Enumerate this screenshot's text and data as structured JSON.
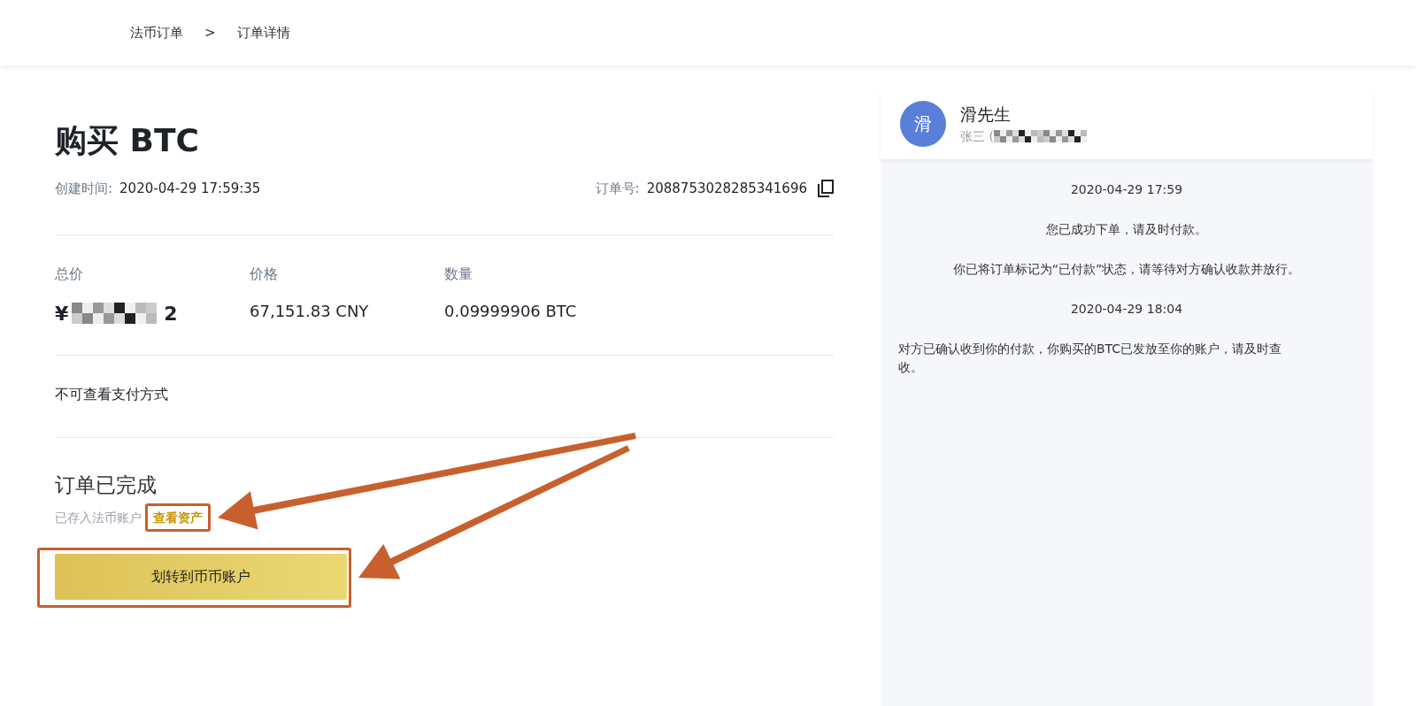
{
  "breadcrumb": [
    {
      "label": "法币订单"
    },
    {
      "label": ">"
    },
    {
      "label": "订单详情"
    }
  ],
  "order": {
    "title": "购买 BTC",
    "created_label": "创建时间:",
    "created_value": "2020-04-29 17:59:35",
    "number_label": "订单号:",
    "number_value": "2088753028285341696",
    "summary": [
      {
        "label": "总价",
        "value_start": "¥",
        "value_end": "2",
        "kind": "redacted"
      },
      {
        "label": "价格",
        "value_start": "67,151.83 CNY",
        "kind": "plain"
      },
      {
        "label": "数量",
        "value_start": "0.09999906 BTC",
        "kind": "plain"
      }
    ],
    "payment_note": "不可查看支付方式",
    "status_title": "订单已完成",
    "status_note": "已存入法币账户",
    "assets_link": "查看资产",
    "transfer_button": "划转到币币账户"
  },
  "chat": {
    "avatar": "滑",
    "name": "滑先生",
    "subtitle": "张三 (",
    "messages": [
      {
        "kind": "time",
        "text": "2020-04-29 17:59"
      },
      {
        "kind": "notice",
        "text": "您已成功下单，请及时付款。"
      },
      {
        "kind": "notice",
        "text": "你已将订单标记为“已付款”状态，请等待对方确认收款并放行。"
      },
      {
        "kind": "time",
        "text": "2020-04-29 18:04"
      },
      {
        "kind": "message",
        "text": "对方已确认收到你的付款，你购买的BTC已发放至你的账户，请及时查收。"
      }
    ]
  }
}
